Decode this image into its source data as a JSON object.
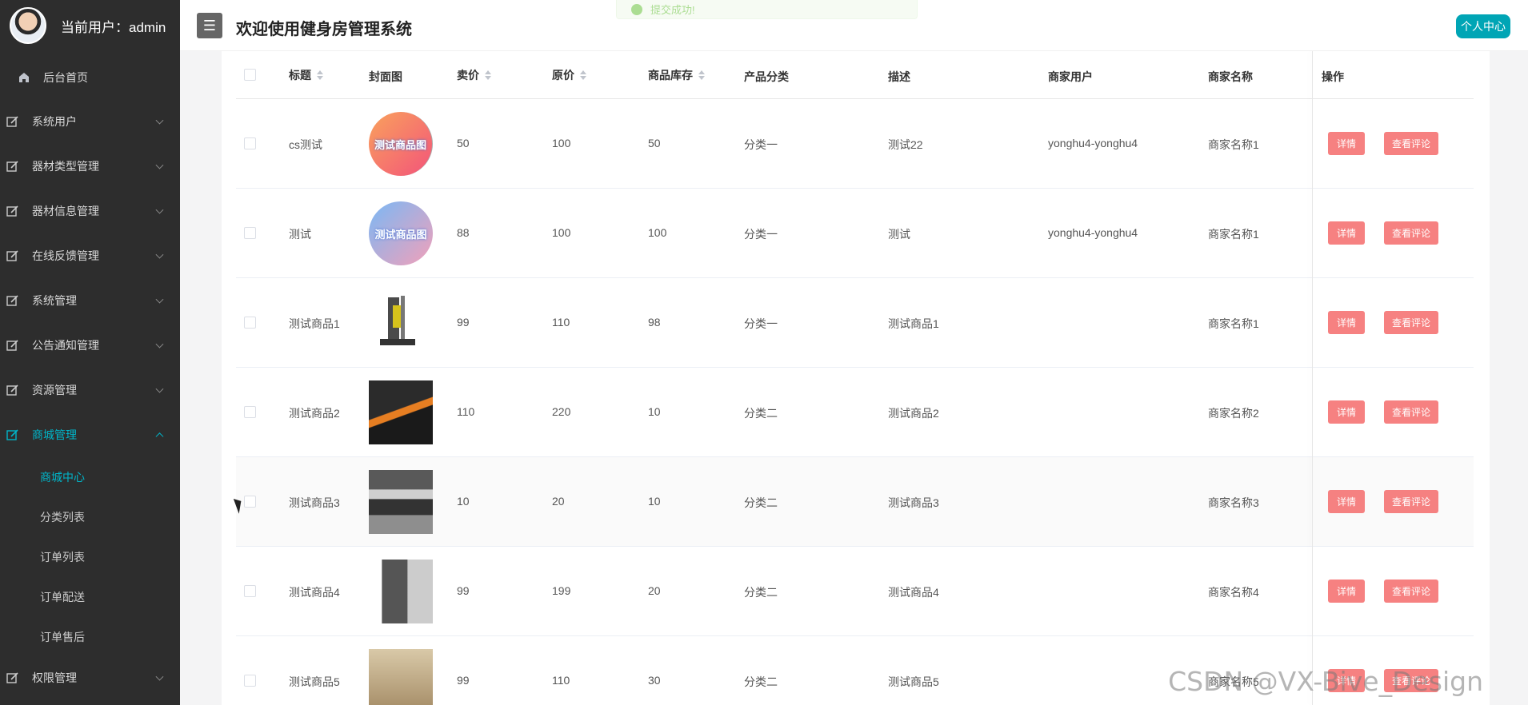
{
  "user": {
    "label": "当前用户：",
    "name": "admin"
  },
  "sidebar": {
    "home": "后台首页",
    "groups": [
      {
        "label": "系统用户"
      },
      {
        "label": "器材类型管理"
      },
      {
        "label": "器材信息管理"
      },
      {
        "label": "在线反馈管理"
      },
      {
        "label": "系统管理"
      },
      {
        "label": "公告通知管理"
      },
      {
        "label": "资源管理"
      },
      {
        "label": "商城管理"
      }
    ],
    "mall_sub": [
      "商城中心",
      "分类列表",
      "订单列表",
      "订单配送",
      "订单售后"
    ],
    "last_group": "权限管理"
  },
  "header": {
    "title": "欢迎使用健身房管理系统",
    "toast": "提交成功!",
    "personal_center": "个人中心"
  },
  "table": {
    "columns": [
      "标题",
      "封面图",
      "卖价",
      "原价",
      "商品库存",
      "产品分类",
      "描述",
      "商家用户",
      "商家名称",
      "操作"
    ],
    "rows": [
      {
        "title": "cs测试",
        "cover": "测试商品图",
        "price": "50",
        "orig": "100",
        "stock": "50",
        "cat": "分类一",
        "desc": "测试22",
        "merchant_user": "yonghu4-yonghu4",
        "merchant": "商家名称1"
      },
      {
        "title": "测试",
        "cover": "测试商品图",
        "price": "88",
        "orig": "100",
        "stock": "100",
        "cat": "分类一",
        "desc": "测试",
        "merchant_user": "yonghu4-yonghu4",
        "merchant": "商家名称1"
      },
      {
        "title": "测试商品1",
        "cover": "",
        "price": "99",
        "orig": "110",
        "stock": "98",
        "cat": "分类一",
        "desc": "测试商品1",
        "merchant_user": "",
        "merchant": "商家名称1"
      },
      {
        "title": "测试商品2",
        "cover": "",
        "price": "110",
        "orig": "220",
        "stock": "10",
        "cat": "分类二",
        "desc": "测试商品2",
        "merchant_user": "",
        "merchant": "商家名称2"
      },
      {
        "title": "测试商品3",
        "cover": "",
        "price": "10",
        "orig": "20",
        "stock": "10",
        "cat": "分类二",
        "desc": "测试商品3",
        "merchant_user": "",
        "merchant": "商家名称3"
      },
      {
        "title": "测试商品4",
        "cover": "",
        "price": "99",
        "orig": "199",
        "stock": "20",
        "cat": "分类二",
        "desc": "测试商品4",
        "merchant_user": "",
        "merchant": "商家名称4"
      },
      {
        "title": "测试商品5",
        "cover": "",
        "price": "99",
        "orig": "110",
        "stock": "30",
        "cat": "分类二",
        "desc": "测试商品5",
        "merchant_user": "",
        "merchant": "商家名称5"
      }
    ],
    "detail_label": "详情",
    "review_label": "查看评论"
  },
  "watermark": "CSDN @VX-Bive_Design",
  "colors": {
    "accent": "#00b5c9",
    "danger": "#f56c6c",
    "sidebar_bg": "#2d2d2d"
  }
}
